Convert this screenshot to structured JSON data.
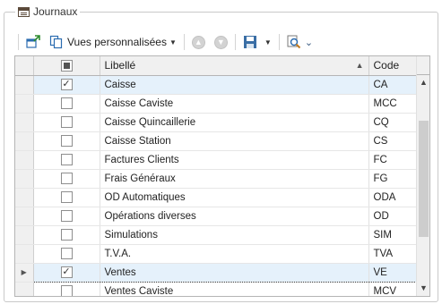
{
  "group": {
    "title": "Journaux",
    "icon": "journal-icon"
  },
  "toolbar": {
    "new_icon": "new-window-icon",
    "views_label": "Vues personnalisées",
    "views_icon": "copy-views-icon",
    "up_icon": "arrow-up-circle-icon",
    "down_icon": "arrow-down-circle-icon",
    "save_icon": "save-icon",
    "search_icon": "search-icon",
    "chevron_icon": "chevron-down-icon"
  },
  "grid": {
    "columns": {
      "libelle": "Libellé",
      "code": "Code"
    },
    "rows": [
      {
        "checked": true,
        "libelle": "Caisse",
        "code": "CA",
        "state": "selected"
      },
      {
        "checked": false,
        "libelle": "Caisse Caviste",
        "code": "MCC"
      },
      {
        "checked": false,
        "libelle": "Caisse Quincaillerie",
        "code": "CQ"
      },
      {
        "checked": false,
        "libelle": "Caisse Station",
        "code": "CS"
      },
      {
        "checked": false,
        "libelle": "Factures Clients",
        "code": "FC"
      },
      {
        "checked": false,
        "libelle": "Frais Généraux",
        "code": "FG"
      },
      {
        "checked": false,
        "libelle": "OD Automatiques",
        "code": "ODA"
      },
      {
        "checked": false,
        "libelle": "Opérations diverses",
        "code": "OD"
      },
      {
        "checked": false,
        "libelle": "Simulations",
        "code": "SIM"
      },
      {
        "checked": false,
        "libelle": "T.V.A.",
        "code": "TVA"
      },
      {
        "checked": true,
        "libelle": "Ventes",
        "code": "VE",
        "state": "focused"
      },
      {
        "checked": false,
        "libelle": "Ventes Caviste",
        "code": "MCV"
      }
    ]
  }
}
